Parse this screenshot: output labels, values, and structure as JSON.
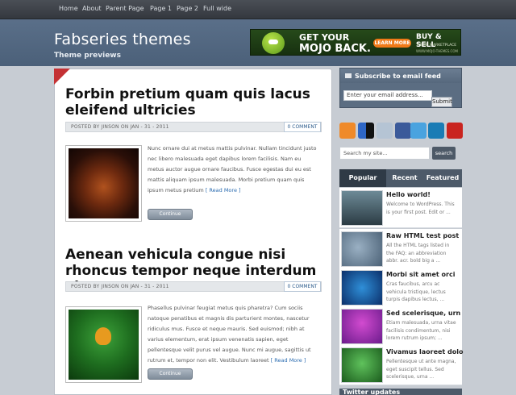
{
  "nav": {
    "items": [
      "Home",
      "About",
      "Parent Page",
      "Page 1",
      "Page 2",
      "Full wide"
    ]
  },
  "header": {
    "title": "Fabseries themes",
    "tagline": "Theme previews"
  },
  "ad": {
    "line1": "GET YOUR",
    "line2": "MOJO BACK.",
    "button": "LEARN MORE",
    "buy": "BUY & SELL",
    "market": "THEME MARKETPLACE",
    "url": "WWW.MOJO-THEMES.COM"
  },
  "posts": [
    {
      "title": "Forbin pretium quam quis lacus eleifend ultricies",
      "meta": "POSTED BY JINSON ON JAN - 31 - 2011",
      "comments": "0 COMMENT",
      "excerpt": "Nunc ornare dui at metus mattis pulvinar. Nullam tincidunt justo nec libero malesuada eget dapibus lorem facilisis. Nam eu metus auctor augue ornare faucibus. Fusce egestas dui eu est mattis aliquam ipsum malesuada. Morbi pretium quam quis ipsum metus pretium",
      "readmore": "[ Read More ]",
      "continue": "Continue"
    },
    {
      "title": "Aenean vehicula congue nisi rhoncus tempor neque interdum vitae",
      "meta": "POSTED BY JINSON ON JAN - 31 - 2011",
      "comments": "0 COMMENT",
      "excerpt": "Phasellus pulvinar feugiat metus quis pharetra? Cum sociis natoque penatibus et magnis dis parturient montes, nascetur ridiculus mus. Fusce et neque mauris. Sed euismod; nibh at varius elementum, erat ipsum venenatis sapien, eget pellentesque velit purus vel augue. Nunc mi augue, sagittis ut rutrum et, tempor non elit. Vestibulum laoreet",
      "readmore": "[ Read More ]",
      "continue": "Continue"
    }
  ],
  "sidebar": {
    "subscribe_title": "Subscribe to email feed",
    "email_value": "Enter your email address...",
    "submit": "Submit",
    "search_placeholder": "Search my site...",
    "search_button": "search",
    "tabs": [
      "Popular",
      "Recent",
      "Featured"
    ],
    "popular": [
      {
        "title": "Hello world!",
        "text": "Welcome to WordPress. This is your first post. Edit or ..."
      },
      {
        "title": "Raw HTML test post",
        "text": "All the HTML tags listed in the FAQ: an abbreviation abbr. acr. bold big a ..."
      },
      {
        "title": "Morbi sit amet orci",
        "text": "Cras faucibus, arcu ac vehicula tristique, lectus turpis dapibus lectus, ..."
      },
      {
        "title": "Sed scelerisque, urn",
        "text": "Etiam malesuada, urna vitae facilisis condimentum, nisi lorem rutrum ipsum; ..."
      },
      {
        "title": "Vivamus laoreet dolo",
        "text": "Pellentesque ut ante magna, eget suscipit tellus. Sed scelerisque, urna ..."
      }
    ],
    "twitter_title": "Twitter updates"
  },
  "social_icons": [
    "rss-icon",
    "delicious-icon",
    "digg-icon",
    "facebook-icon",
    "twitter-icon",
    "linkedin-icon",
    "youtube-icon"
  ]
}
